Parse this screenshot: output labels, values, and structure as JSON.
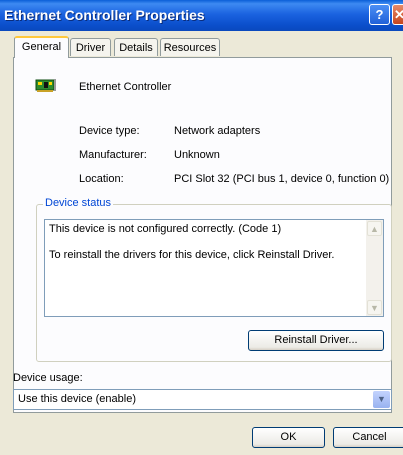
{
  "window": {
    "title": "Ethernet Controller Properties",
    "help_glyph": "?",
    "close_glyph": "✕"
  },
  "tabs": [
    {
      "label": "General",
      "active": true
    },
    {
      "label": "Driver"
    },
    {
      "label": "Details"
    },
    {
      "label": "Resources"
    }
  ],
  "device": {
    "icon": "network-card-icon",
    "name": "Ethernet Controller",
    "properties": [
      {
        "label": "Device type:",
        "value": "Network adapters"
      },
      {
        "label": "Manufacturer:",
        "value": "Unknown"
      },
      {
        "label": "Location:",
        "value": "PCI Slot 32 (PCI bus 1, device 0, function 0)"
      }
    ]
  },
  "status": {
    "group_label": "Device status",
    "lines": [
      "This device is not configured correctly. (Code 1)",
      "To reinstall the drivers for this device, click Reinstall Driver."
    ],
    "reinstall_label": "Reinstall Driver..."
  },
  "usage": {
    "label": "Device usage:",
    "value": "Use this device (enable)"
  },
  "buttons": {
    "ok": "OK",
    "cancel": "Cancel"
  },
  "colors": {
    "titlebar": "#0a5fd8",
    "group_label": "#0046d5",
    "dialog_bg": "#ece9d8"
  }
}
